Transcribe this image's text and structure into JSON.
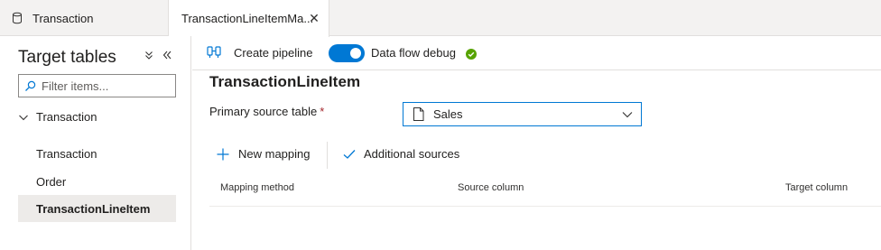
{
  "tabs": [
    {
      "label": "Transaction",
      "icon": "database-icon"
    },
    {
      "label": "TransactionLineItemMa...",
      "icon": "none",
      "close_symbol": "✕"
    }
  ],
  "sidebar": {
    "title": "Target tables",
    "filter_placeholder": "Filter items...",
    "group": {
      "label": "Transaction",
      "expanded": true
    },
    "items": [
      {
        "label": "Transaction",
        "selected": false
      },
      {
        "label": "Order",
        "selected": false
      },
      {
        "label": "TransactionLineItem",
        "selected": true
      }
    ]
  },
  "toolbar": {
    "create_pipeline_label": "Create pipeline",
    "debug_label": "Data flow debug",
    "debug_on": true,
    "debug_status": "success"
  },
  "main": {
    "title": "TransactionLineItem",
    "primary_source_label": "Primary source table",
    "required_marker": "*",
    "primary_source_value": "Sales",
    "actions": {
      "new_mapping_label": "New mapping",
      "additional_sources_label": "Additional sources"
    },
    "columns": [
      "Mapping method",
      "Source column",
      "Target column"
    ]
  },
  "colors": {
    "accent": "#0078d4",
    "success": "#57a300",
    "required": "#a4262c",
    "selected_bg": "#edebe9"
  }
}
